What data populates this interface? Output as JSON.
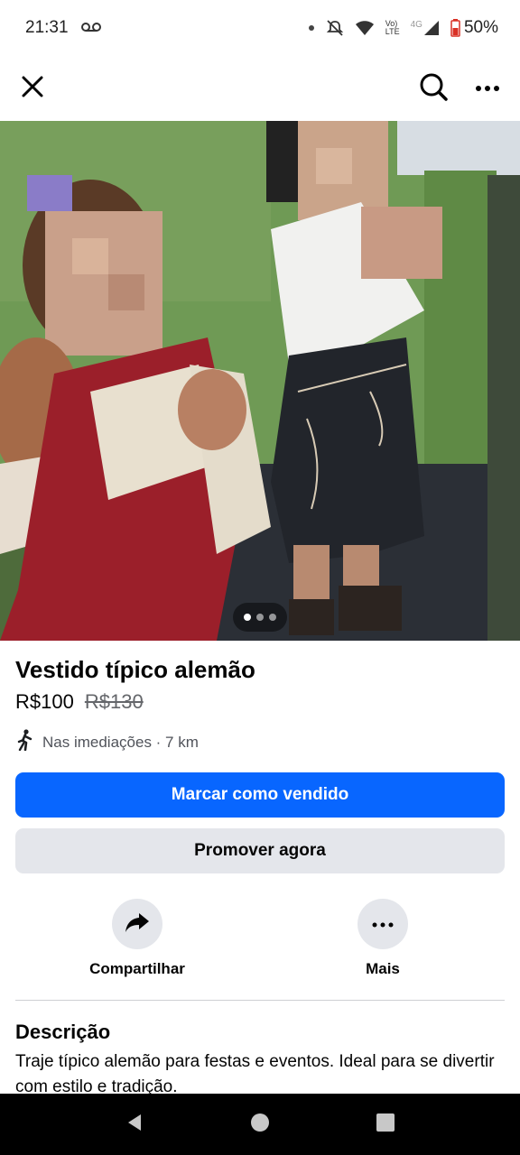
{
  "status_bar": {
    "time": "21:31",
    "volte_label": "Vo)",
    "lte_label": "LTE",
    "network_label": "4G",
    "battery": "50%",
    "icons": [
      "voicemail-icon",
      "dot-icon",
      "mute-icon",
      "wifi-icon",
      "signal-icon",
      "battery-icon"
    ]
  },
  "top_nav": {
    "icons": [
      "close-icon",
      "search-icon",
      "more-icon"
    ]
  },
  "gallery": {
    "dot_count": 3,
    "active_index": 0
  },
  "listing": {
    "title": "Vestido típico alemão",
    "price": "R$100",
    "old_price": "R$130",
    "location": "Nas imediações · 7 km"
  },
  "buttons": {
    "mark_sold": "Marcar como vendido",
    "promote": "Promover agora"
  },
  "actions": {
    "share": "Compartilhar",
    "more": "Mais"
  },
  "description": {
    "heading": "Descrição",
    "text": "Traje típico alemão para festas e eventos. Ideal para se divertir com estilo e tradição."
  },
  "colors": {
    "primary": "#0866ff",
    "secondary_bg": "#e4e6eb"
  }
}
